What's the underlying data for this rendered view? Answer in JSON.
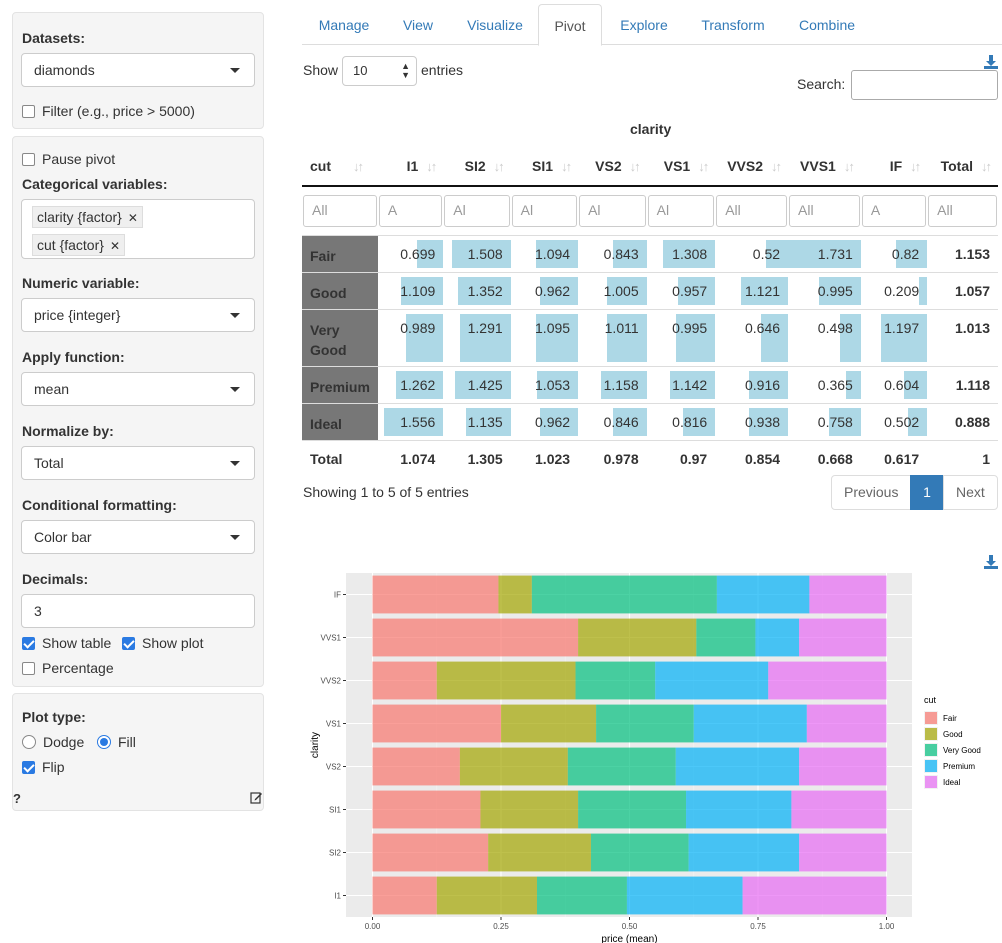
{
  "sidebar": {
    "datasets_label": "Datasets:",
    "dataset_value": "diamonds",
    "filter_label": "Filter (e.g., price > 5000)",
    "pause_label": "Pause pivot",
    "catvars_label": "Categorical variables:",
    "catvars": [
      "clarity {factor}",
      "cut {factor}"
    ],
    "numvar_label": "Numeric variable:",
    "numvar_value": "price {integer}",
    "fun_label": "Apply function:",
    "fun_value": "mean",
    "norm_label": "Normalize by:",
    "norm_value": "Total",
    "cf_label": "Conditional formatting:",
    "cf_value": "Color bar",
    "dec_label": "Decimals:",
    "dec_value": "3",
    "show_table_label": "Show table",
    "show_plot_label": "Show plot",
    "percentage_label": "Percentage",
    "plottype_label": "Plot type:",
    "dodge_label": "Dodge",
    "fill_label": "Fill",
    "flip_label": "Flip",
    "help_label": "?"
  },
  "tabs": [
    "Manage",
    "View",
    "Visualize",
    "Pivot",
    "Explore",
    "Transform",
    "Combine"
  ],
  "active_tab": "Pivot",
  "controls": {
    "show_label": "Show",
    "entries_value": "10",
    "entries_label": "entries",
    "search_label": "Search:"
  },
  "table": {
    "group_header": "clarity",
    "columns": [
      "cut",
      "I1",
      "SI2",
      "SI1",
      "VS2",
      "VS1",
      "VVS2",
      "VVS1",
      "IF",
      "Total"
    ],
    "filters": [
      "All",
      "A",
      "Al",
      "Al",
      "Al",
      "Al",
      "All",
      "All",
      "A",
      "All"
    ],
    "rows": [
      {
        "label": "Fair",
        "values": [
          "0.699",
          "1.508",
          "1.094",
          "0.843",
          "1.308",
          "0.52",
          "1.731",
          "0.82"
        ],
        "bars": [
          0.4,
          0.87,
          0.63,
          0.49,
          0.76,
          0.3,
          1.0,
          0.47
        ],
        "total": "1.153"
      },
      {
        "label": "Good",
        "values": [
          "1.109",
          "1.352",
          "0.962",
          "1.005",
          "0.957",
          "1.121",
          "0.995",
          "0.209"
        ],
        "bars": [
          0.64,
          0.78,
          0.56,
          0.58,
          0.55,
          0.65,
          0.57,
          0.12
        ],
        "total": "1.057"
      },
      {
        "label": "Very Good",
        "values": [
          "0.989",
          "1.291",
          "1.095",
          "1.011",
          "0.995",
          "0.646",
          "0.498",
          "1.197"
        ],
        "bars": [
          0.57,
          0.75,
          0.63,
          0.58,
          0.57,
          0.37,
          0.29,
          0.69
        ],
        "total": "1.013"
      },
      {
        "label": "Premium",
        "values": [
          "1.262",
          "1.425",
          "1.053",
          "1.158",
          "1.142",
          "0.916",
          "0.365",
          "0.604"
        ],
        "bars": [
          0.73,
          0.82,
          0.61,
          0.67,
          0.66,
          0.53,
          0.21,
          0.35
        ],
        "total": "1.118"
      },
      {
        "label": "Ideal",
        "values": [
          "1.556",
          "1.135",
          "0.962",
          "0.846",
          "0.816",
          "0.938",
          "0.758",
          "0.502"
        ],
        "bars": [
          0.9,
          0.66,
          0.56,
          0.49,
          0.47,
          0.54,
          0.44,
          0.29
        ],
        "total": "0.888"
      }
    ],
    "total_row": {
      "label": "Total",
      "values": [
        "1.074",
        "1.305",
        "1.023",
        "0.978",
        "0.97",
        "0.854",
        "0.668",
        "0.617"
      ],
      "total": "1"
    }
  },
  "footer": {
    "info": "Showing 1 to 5 of 5 entries",
    "previous": "Previous",
    "page": "1",
    "next": "Next"
  },
  "colors": {
    "bar": "#add8e6",
    "row_header": "#777777",
    "accent": "#337ab7",
    "Fair": "#F8766D",
    "Good": "#A3A500",
    "Very Good": "#00BF7D",
    "Premium": "#00B0F6",
    "Ideal": "#E76BF3"
  },
  "chart_data": {
    "type": "bar",
    "orientation": "horizontal-stacked-fill",
    "categories": [
      "I1",
      "SI2",
      "SI1",
      "VS2",
      "VS1",
      "VVS2",
      "VVS1",
      "IF"
    ],
    "series": [
      {
        "name": "Fair",
        "values": [
          0.125,
          0.225,
          0.21,
          0.17,
          0.25,
          0.125,
          0.4,
          0.245
        ]
      },
      {
        "name": "Good",
        "values": [
          0.195,
          0.2,
          0.19,
          0.21,
          0.185,
          0.27,
          0.23,
          0.065
        ]
      },
      {
        "name": "Very Good",
        "values": [
          0.175,
          0.19,
          0.21,
          0.21,
          0.19,
          0.155,
          0.115,
          0.36
        ]
      },
      {
        "name": "Premium",
        "values": [
          0.225,
          0.215,
          0.205,
          0.24,
          0.22,
          0.22,
          0.085,
          0.18
        ]
      },
      {
        "name": "Ideal",
        "values": [
          0.28,
          0.17,
          0.185,
          0.17,
          0.155,
          0.23,
          0.17,
          0.15
        ]
      }
    ],
    "xlabel": "price (mean)",
    "ylabel": "clarity",
    "legend_title": "cut",
    "legend_position": "right",
    "xlim": [
      0,
      1
    ],
    "xticks": [
      "0.00",
      "0.25",
      "0.50",
      "0.75",
      "1.00"
    ],
    "grid": true
  }
}
